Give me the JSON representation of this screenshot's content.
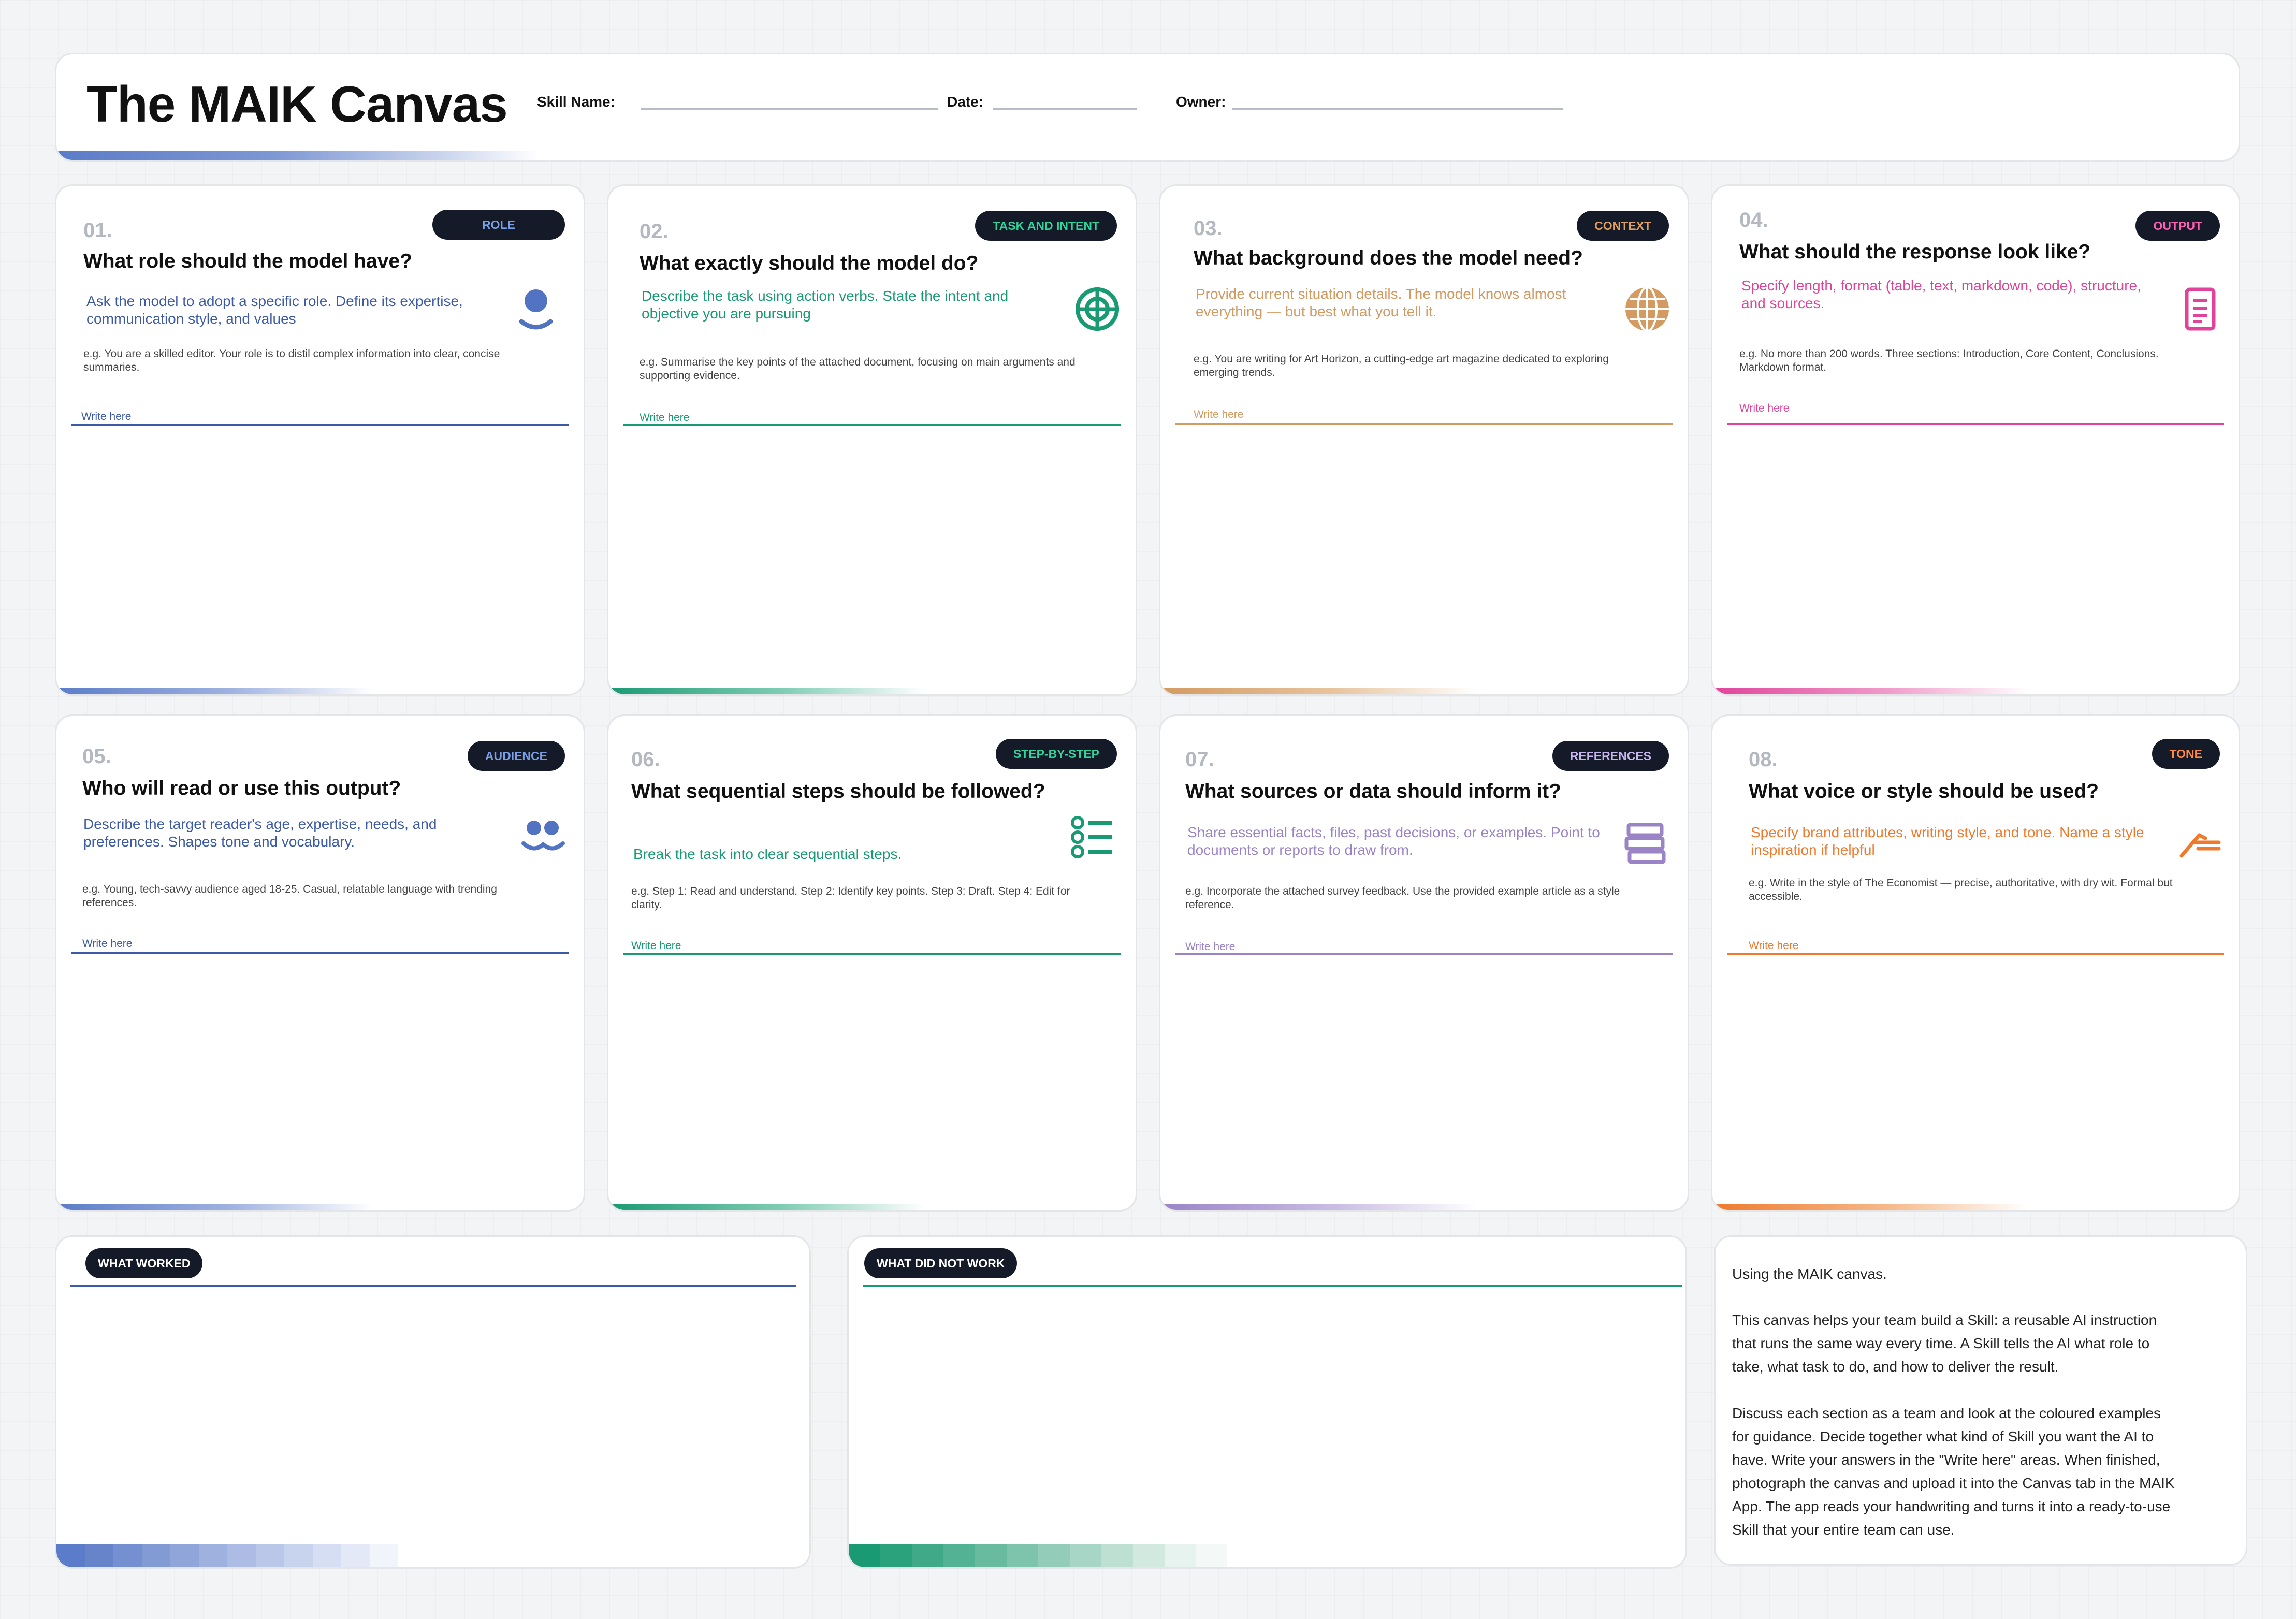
{
  "header": {
    "title": "The MAIK Canvas",
    "skill_name_label": "Skill Name:",
    "date_label": "Date:",
    "owner_label": "Owner:"
  },
  "cards": [
    {
      "number": "01.",
      "tag": "ROLE",
      "question": "What role should the model have?",
      "description": "Ask the model to adopt a specific role. Define its expertise, communication style, and values",
      "example": "e.g. You are a skilled editor. Your role is to distil complex information into clear, concise summaries.",
      "write_label": "Write here",
      "color": "#3d5aa8",
      "icon": "person-icon"
    },
    {
      "number": "02.",
      "tag": "TASK AND INTENT",
      "question": "What exactly should the model do?",
      "description": "Describe the task using action verbs. State the intent and objective you are pursuing",
      "example": "e.g. Summarise the key points of the attached document, focusing on main arguments and supporting evidence.",
      "write_label": "Write here",
      "color": "#1a9a73",
      "icon": "target-icon"
    },
    {
      "number": "03.",
      "tag": "CONTEXT",
      "question": "What background does the model need?",
      "description": "Provide current situation details. The model knows almost everything — but best what you tell it.",
      "example": "e.g. You are writing for Art Horizon, a cutting-edge art magazine dedicated to exploring emerging trends.",
      "write_label": "Write here",
      "color": "#d39a62",
      "icon": "globe-icon"
    },
    {
      "number": "04.",
      "tag": "OUTPUT",
      "question": "What should the response look like?",
      "description": "Specify length, format (table, text, markdown, code), structure, and sources.",
      "example": "e.g. No more than 200 words. Three sections: Introduction, Core Content, Conclusions. Markdown format.",
      "write_label": "Write here",
      "color": "#e0449a",
      "icon": "document-icon"
    },
    {
      "number": "05.",
      "tag": "AUDIENCE",
      "question": "Who will read or use this output?",
      "description": "Describe the target reader's age, expertise, needs, and preferences. Shapes tone and vocabulary.",
      "example": "e.g. Young, tech-savvy audience aged 18-25. Casual, relatable language with trending references.",
      "write_label": "Write here",
      "color": "#3d5aa8",
      "icon": "audience-icon"
    },
    {
      "number": "06.",
      "tag": "STEP-BY-STEP",
      "question": "What sequential steps should be followed?",
      "description": "Break the task into clear sequential steps.",
      "example": "e.g. Step 1: Read and understand. Step 2: Identify key points. Step 3: Draft. Step 4: Edit for clarity.",
      "write_label": "Write here",
      "color": "#1a9a73",
      "icon": "steps-icon"
    },
    {
      "number": "07.",
      "tag": "REFERENCES",
      "question": "What sources or data should inform it?",
      "description": "Share essential facts, files, past decisions, or examples. Point to documents or reports to draw from.",
      "example": "e.g. Incorporate the attached survey feedback. Use the provided example article as a style reference.",
      "write_label": "Write here",
      "color": "#9a84c6",
      "icon": "books-icon"
    },
    {
      "number": "08.",
      "tag": "TONE",
      "question": "What voice or style should be used?",
      "description": "Specify brand attributes, writing style, and tone. Name a style inspiration if helpful",
      "example": "e.g. Write in the style of The Economist — precise, authoritative, with dry wit. Formal but accessible.",
      "write_label": "Write here",
      "color": "#ef7a2d",
      "icon": "pen-icon"
    }
  ],
  "what_worked": {
    "label": "WHAT WORKED",
    "color": "#3d5aa8"
  },
  "what_did_not_work": {
    "label": "WHAT DID NOT WORK",
    "color": "#1a9a73"
  },
  "info": {
    "title": "Using the MAIK canvas.",
    "paragraph1": "This canvas helps your team build a Skill: a reusable AI instruction that runs the same way every time. A Skill tells the AI what role to take, what task to do, and how to deliver the result.",
    "paragraph2": "Discuss each section as a team and look at the coloured examples for guidance. Decide together what kind of Skill you want the AI to have. Write your answers in the \"Write here\" areas. When finished, photograph the canvas and upload it into the Canvas tab in the MAIK App. The app reads your handwriting and turns it into a ready-to-use Skill that your entire team can use."
  }
}
